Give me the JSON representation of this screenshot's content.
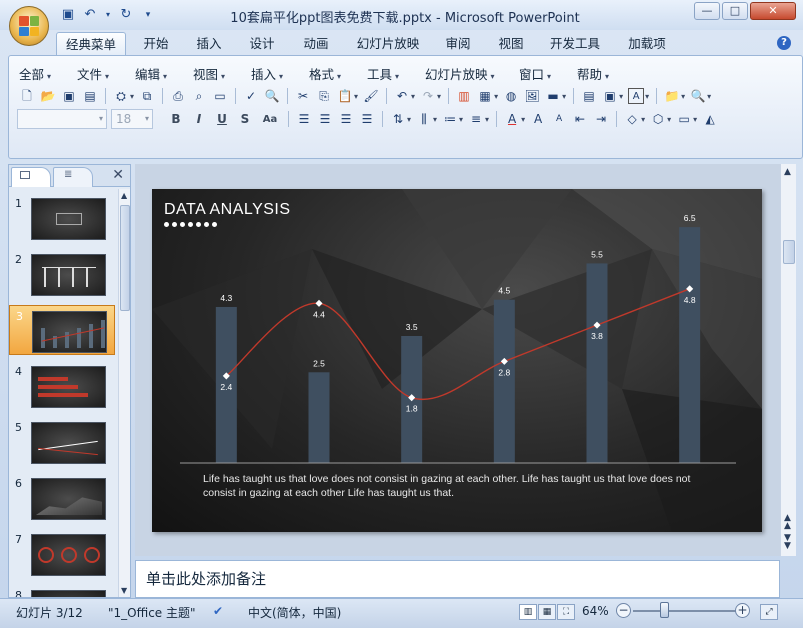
{
  "window": {
    "title": "10套扁平化ppt图表免费下载.pptx - Microsoft PowerPoint",
    "controls": {
      "minimize": "—",
      "maximize": "□",
      "close": "✕"
    }
  },
  "quick_access": {
    "save": "save-icon",
    "undo": "undo-icon",
    "redo": "redo-icon",
    "customize": "▾"
  },
  "ribbon_tabs": [
    "经典菜单",
    "开始",
    "插入",
    "设计",
    "动画",
    "幻灯片放映",
    "审阅",
    "视图",
    "开发工具",
    "加载项"
  ],
  "active_tab": "经典菜单",
  "menus": [
    "全部",
    "文件",
    "编辑",
    "视图",
    "插入",
    "格式",
    "工具",
    "幻灯片放映",
    "窗口",
    "帮助"
  ],
  "font": {
    "name": "",
    "size": "18"
  },
  "format_buttons": [
    "B",
    "I",
    "U",
    "S",
    "Aa"
  ],
  "slides": {
    "total": 12,
    "current": 3,
    "visible_numbers": [
      "1",
      "2",
      "3",
      "4",
      "5",
      "6",
      "7",
      "8"
    ]
  },
  "slide": {
    "title": "DATA ANALYSIS",
    "body_text": "Life has taught us that love does not consist in gazing at each other. Life has taught us that love does not consist in gazing at each other Life has taught us that."
  },
  "chart_data": {
    "type": "bar",
    "categories": [
      "",
      "",
      "",
      "",
      "",
      ""
    ],
    "series": [
      {
        "values": [
          4.3,
          2.5,
          3.5,
          4.5,
          5.5,
          6.5
        ],
        "color": "#3f4f60"
      },
      {
        "type": "line",
        "values": [
          2.4,
          4.4,
          1.8,
          2.8,
          3.8,
          4.8
        ],
        "color": "#c0392b"
      }
    ],
    "ylim": [
      0,
      7
    ],
    "grid": false
  },
  "notes_placeholder": "单击此处添加备注",
  "status": {
    "slide_indicator": "幻灯片 3/12",
    "theme": "\"1_Office 主题\"",
    "language": "中文(简体，中国)",
    "zoom": "64%"
  }
}
